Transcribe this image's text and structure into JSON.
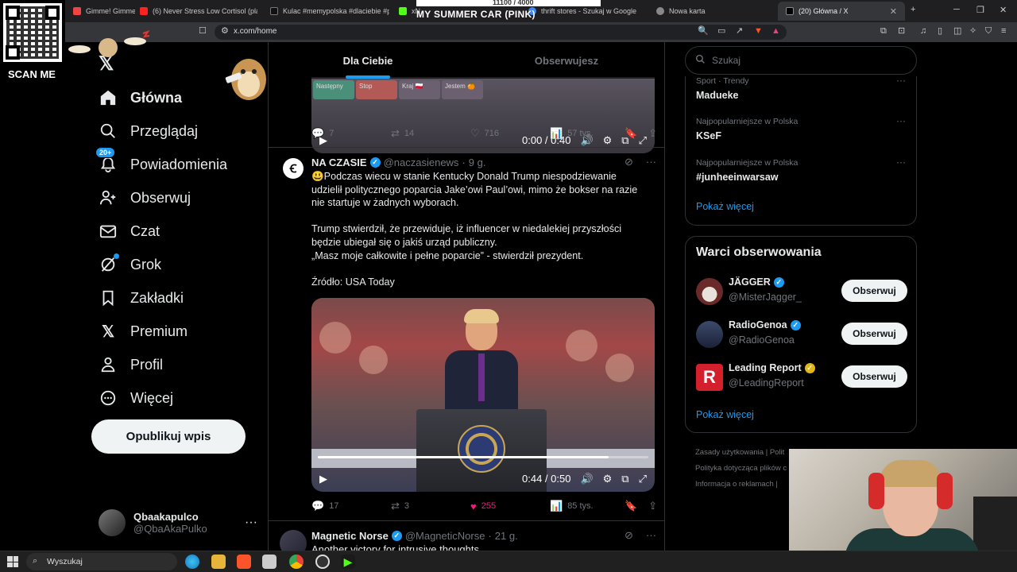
{
  "browser": {
    "tabs": [
      {
        "title": "Gimme! Gimme! Gimm",
        "color": "#e44"
      },
      {
        "title": "(6) Never Stress Low Cortisol (playlis",
        "color": "#f22"
      },
      {
        "title": "Kulac #memypolska #dlaciebie #po",
        "color": "#111"
      },
      {
        "title": "xN",
        "color": "#53fc18"
      },
      {
        "title": "thrift stores - Szukaj w Google",
        "color": "#4285f4"
      },
      {
        "title": "Nowa karta",
        "color": "#888"
      },
      {
        "title": "(20) Główna / X",
        "color": "#000"
      }
    ],
    "overlay_count": "11100 / 4000",
    "overlay_song": "MY SUMMER CAR (PINK)",
    "url": "x.com/home"
  },
  "overlays": {
    "qr_label": "SCAN ME"
  },
  "nav": {
    "items": [
      {
        "label": "Główna",
        "icon": "home-icon"
      },
      {
        "label": "Przeglądaj",
        "icon": "search-icon"
      },
      {
        "label": "Powiadomienia",
        "icon": "bell-icon",
        "badge": "20+"
      },
      {
        "label": "Obserwuj",
        "icon": "follow-icon"
      },
      {
        "label": "Czat",
        "icon": "mail-icon"
      },
      {
        "label": "Grok",
        "icon": "grok-icon"
      },
      {
        "label": "Zakładki",
        "icon": "bookmark-icon"
      },
      {
        "label": "Premium",
        "icon": "x-icon"
      },
      {
        "label": "Profil",
        "icon": "person-icon"
      },
      {
        "label": "Więcej",
        "icon": "more-icon"
      }
    ],
    "post_label": "Opublikuj wpis"
  },
  "account": {
    "name": "Qbaakapulco",
    "handle": "@QbaAkaPulko",
    "more": "···"
  },
  "feed": {
    "tabs": [
      "Dla Ciebie",
      "Obserwujesz"
    ],
    "top_video": {
      "buttons": [
        "Następny",
        "Stop",
        "Kraj 🇵🇱",
        "Jestem 🍊"
      ],
      "time": "0:00 / 0:40",
      "progress": 0.0
    },
    "tweet1_actions": {
      "replies": "7",
      "reposts": "14",
      "likes": "716",
      "views": "57 tys."
    },
    "tweet2": {
      "name": "NA CZASIE",
      "handle": "@naczasienews",
      "sep": "·",
      "time": "9 g.",
      "paragraphs": [
        "😃Podczas wiecu w stanie Kentucky Donald Trump niespodziewanie udzielił politycznego poparcia Jake’owi Paul’owi, mimo że bokser na razie nie startuje w żadnych wyborach.",
        "Trump stwierdził, że przewiduje, iż influencer w niedalekiej przyszłości będzie ubiegał się o jakiś urząd publiczny.\n„Masz moje całkowite i pełne poparcie” - stwierdził prezydent.",
        "Źródło: USA Today"
      ],
      "video": {
        "time": "0:44 / 0:50",
        "progress": 0.88
      },
      "actions": {
        "replies": "17",
        "reposts": "3",
        "likes": "255",
        "views": "85 tys."
      }
    },
    "tweet3": {
      "name": "Magnetic Norse",
      "handle": "@MagneticNorse",
      "sep": "·",
      "time": "21 g.",
      "text": "Another victory for intrusive thoughts"
    }
  },
  "sidebar": {
    "search_placeholder": "Szukaj",
    "trends": [
      {
        "context": "Sport · Trendy",
        "title": "Madueke"
      },
      {
        "context": "Najpopularniejsze w Polska",
        "title": "KSeF"
      },
      {
        "context": "Najpopularniejsze w Polska",
        "title": "#junheeinwarsaw"
      }
    ],
    "trends_more": "Pokaż więcej",
    "who_title": "Warci obserwowania",
    "who": [
      {
        "name": "JÄGGER",
        "handle": "@MisterJagger_",
        "verified": "blue",
        "btn": "Obserwuj"
      },
      {
        "name": "RadioGenoa",
        "handle": "@RadioGenoa",
        "verified": "blue",
        "btn": "Obserwuj"
      },
      {
        "name": "Leading Report",
        "handle": "@LeadingReport",
        "verified": "gold",
        "btn": "Obserwuj"
      }
    ],
    "who_more": "Pokaż więcej",
    "footer": [
      "Zasady użytkowania  |  Polit",
      "Polityka dotycząca plików c",
      "Informacja o reklamach  |"
    ]
  },
  "taskbar": {
    "search_placeholder": "Wyszukaj"
  }
}
